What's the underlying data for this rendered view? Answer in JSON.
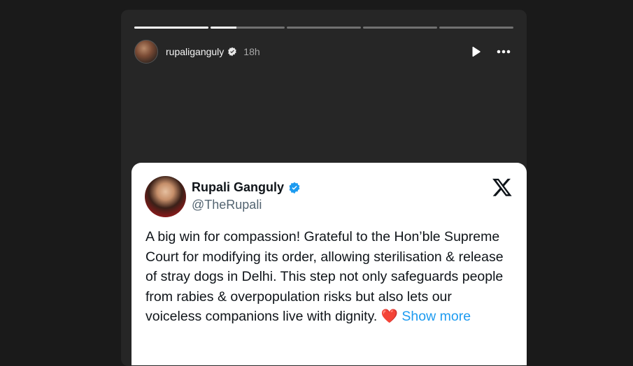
{
  "story": {
    "progress": [
      1,
      0.35,
      0,
      0,
      0
    ],
    "username": "rupaliganguly",
    "time_ago": "18h",
    "icons": {
      "verified": "verified-badge-icon",
      "play": "play-icon",
      "more": "more-options-icon"
    }
  },
  "tweet": {
    "display_name": "Rupali Ganguly",
    "handle": "@TheRupali",
    "text": "A big win for compassion! Grateful to the Hon’ble Supreme Court for modifying its order, allowing sterilisation & release of stray dogs in Delhi. This step not only safeguards people from rabies & overpopulation risks but also lets our voiceless companions live with dignity.",
    "emoji": "❤️",
    "show_more": "Show more",
    "link_color": "#1d9bf0"
  }
}
